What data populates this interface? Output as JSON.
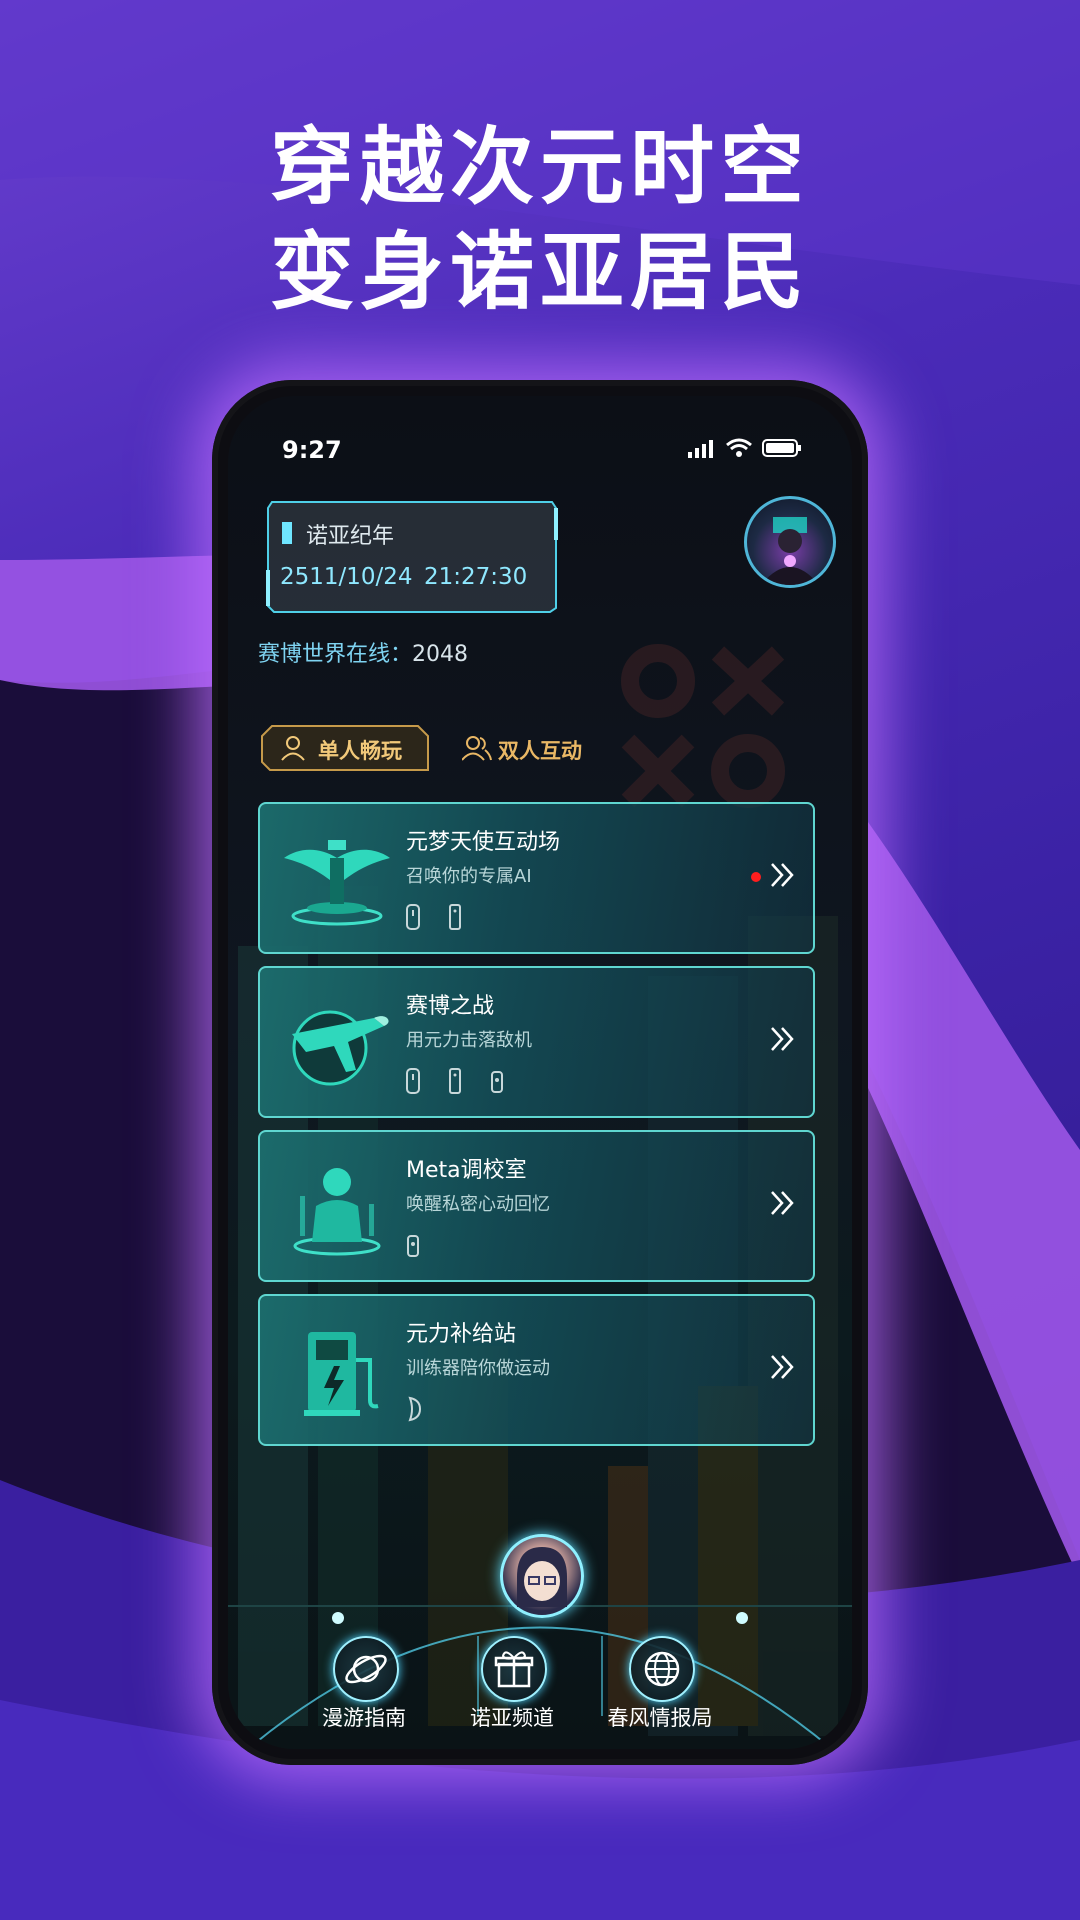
{
  "promo": {
    "headline_1": "穿越次元时空",
    "headline_2": "变身诺亚居民"
  },
  "status_bar": {
    "time": "9:27"
  },
  "date_panel": {
    "title": "诺亚纪年",
    "date": "2511/10/24",
    "time": "21:27:30"
  },
  "online": {
    "label": "赛博世界在线：",
    "count": "2048"
  },
  "tabs": [
    {
      "label": "单人畅玩",
      "active": true
    },
    {
      "label": "双人互动",
      "active": false
    }
  ],
  "cards": [
    {
      "title": "元梦天使互动场",
      "subtitle": "召唤你的专属AI",
      "icon": "angel-wings-icon",
      "has_red_dot": true,
      "devices": 2
    },
    {
      "title": "赛博之战",
      "subtitle": "用元力击落敌机",
      "icon": "plane-icon",
      "has_red_dot": false,
      "devices": 3
    },
    {
      "title": "Meta调校室",
      "subtitle": "唤醒私密心动回忆",
      "icon": "person-icon",
      "has_red_dot": false,
      "devices": 1
    },
    {
      "title": "元力补给站",
      "subtitle": "训练器陪你做运动",
      "icon": "charging-station-icon",
      "has_red_dot": false,
      "devices": 1
    }
  ],
  "bottom_nav": [
    {
      "label": "漫游指南",
      "icon": "planet-icon"
    },
    {
      "label": "诺亚频道",
      "icon": "gift-icon"
    },
    {
      "label": "春风情报局",
      "icon": "globe-icon"
    }
  ],
  "colors": {
    "accent_cyan": "#5fd6d0",
    "tab_gold": "#f2c97a",
    "glow_purple": "#be6eff"
  }
}
